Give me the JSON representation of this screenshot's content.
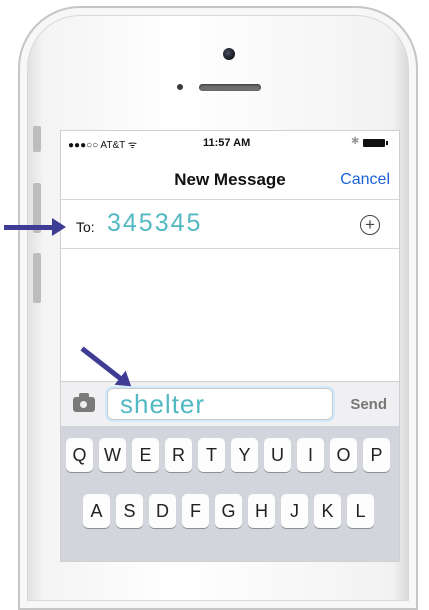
{
  "status_bar": {
    "carrier": "●●●○○ AT&T ᯤ",
    "time": "11:57 AM",
    "bluetooth_icon": "bluetooth-icon",
    "battery_icon": "battery-icon"
  },
  "nav": {
    "title": "New Message",
    "cancel_label": "Cancel"
  },
  "recipient": {
    "label": "To:",
    "value": "345345",
    "add_icon": "+"
  },
  "composer": {
    "camera_icon": "camera-icon",
    "message_text": "shelter",
    "send_label": "Send"
  },
  "keyboard": {
    "row1": [
      "Q",
      "W",
      "E",
      "R",
      "T",
      "Y",
      "U",
      "I",
      "O",
      "P"
    ],
    "row2": [
      "A",
      "S",
      "D",
      "F",
      "G",
      "H",
      "J",
      "K",
      "L"
    ]
  },
  "colors": {
    "accent_blue": "#1d63d8",
    "typed_text": "#52b9c3",
    "arrow": "#3f3c96"
  }
}
